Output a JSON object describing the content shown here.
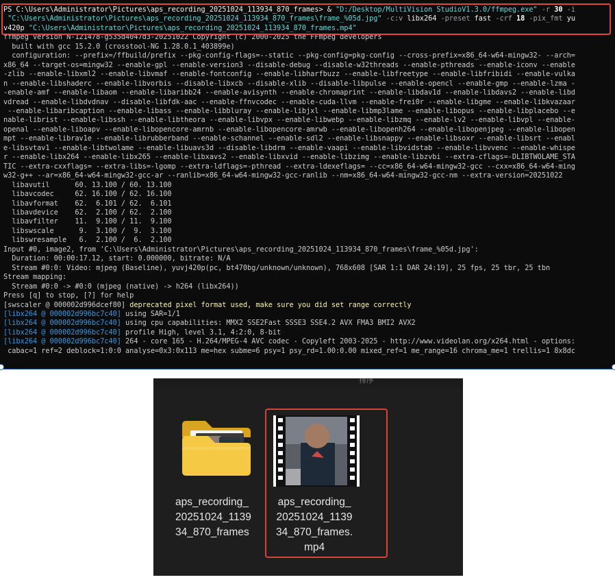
{
  "terminal": {
    "lines": [
      [
        [
          "PS C:\\Users\\Administrator\\Pictures\\aps_recording_20251024_113934_870_frames> ",
          "p"
        ],
        [
          "& ",
          "p"
        ],
        [
          "\"D:/Desktop/MultiVision StudioV1.3.0/ffmpeg.exe\"",
          "s"
        ],
        [
          " -r ",
          "g"
        ],
        [
          "30",
          "wb"
        ],
        [
          " -i",
          "g"
        ]
      ],
      [
        [
          " \"C:\\Users\\Administrator\\Pictures\\aps_recording_20251024_113934_870_frames\\frame_%05d.jpg\"",
          "s"
        ],
        [
          " -c:v ",
          "g"
        ],
        [
          "libx264",
          "p"
        ],
        [
          " -preset ",
          "g"
        ],
        [
          "fast",
          "p"
        ],
        [
          " -crf ",
          "g"
        ],
        [
          "18",
          "wb"
        ],
        [
          " -pix_fmt ",
          "g"
        ],
        [
          "yu",
          "p"
        ]
      ],
      [
        [
          "v420p ",
          "p"
        ],
        [
          "\"C:\\Users\\Administrator\\Pictures\\aps_recording_20251024_113934_870_frames.mp4\"",
          "s"
        ]
      ],
      [
        [
          "ffmpeg version N-121478-g535d4047d3-20251022 Copyright (c) 2000-2025 the FFmpeg developers",
          "w"
        ]
      ],
      [
        [
          "  built with gcc 15.2.0 (crosstool-NG 1.28.0.1_403899e)",
          "w"
        ]
      ],
      [
        [
          "  configuration: --prefix=/ffbuild/prefix --pkg-config-flags=--static --pkg-config=pkg-config --cross-prefix=x86_64-w64-mingw32- --arch=",
          "w"
        ]
      ],
      [
        [
          "x86_64 --target-os=mingw32 --enable-gpl --enable-version3 --disable-debug --disable-w32threads --enable-pthreads --enable-iconv --enable",
          "w"
        ]
      ],
      [
        [
          "-zlib --enable-libxml2 --enable-libvmaf --enable-fontconfig --enable-libharfbuzz --enable-libfreetype --enable-libfribidi --enable-vulka",
          "w"
        ]
      ],
      [
        [
          "n --enable-libshaderc --enable-libvorbis --disable-libxcb --disable-xlib --disable-libpulse --enable-opencl --enable-gmp --enable-lzma -",
          "w"
        ]
      ],
      [
        [
          "-enable-amf --enable-libaom --enable-libaribb24 --enable-avisynth --enable-chromaprint --enable-libdav1d --enable-libdavs2 --enable-libd",
          "w"
        ]
      ],
      [
        [
          "vdread --enable-libdvdnav --disable-libfdk-aac --enable-ffnvcodec --enable-cuda-llvm --enable-frei0r --enable-libgme --enable-libkvazaar",
          "w"
        ]
      ],
      [
        [
          " --enable-libaribcaption --enable-libass --enable-libbluray --enable-libjxl --enable-libmp3lame --enable-libopus --enable-libplacebo --e",
          "w"
        ]
      ],
      [
        [
          "nable-librist --enable-libssh --enable-libtheora --enable-libvpx --enable-libwebp --enable-libzmq --enable-lv2 --enable-libvpl --enable-",
          "w"
        ]
      ],
      [
        [
          "openal --enable-liboapv --enable-libopencore-amrnb --enable-libopencore-amrwb --enable-libopenh264 --enable-libopenjpeg --enable-libopen",
          "w"
        ]
      ],
      [
        [
          "mpt --enable-librav1e --enable-librubberband --enable-schannel --enable-sdl2 --enable-libsnappy --enable-libsoxr --enable-libsrt --enabl",
          "w"
        ]
      ],
      [
        [
          "e-libsvtav1 --enable-libtwolame --enable-libuavs3d --disable-libdrm --enable-vaapi --enable-libvidstab --enable-libvvenc --enable-whispe",
          "w"
        ]
      ],
      [
        [
          "r --enable-libx264 --enable-libx265 --enable-libxavs2 --enable-libxvid --enable-libzimg --enable-libzvbi --extra-cflags=-DLIBTWOLAME_STA",
          "w"
        ]
      ],
      [
        [
          "TIC --extra-cxxflags= --extra-libs=-lgomp --extra-ldflags=-pthread --extra-ldexeflags= --cc=x86_64-w64-mingw32-gcc --cxx=x86_64-w64-ming",
          "w"
        ]
      ],
      [
        [
          "w32-g++ --ar=x86_64-w64-mingw32-gcc-ar --ranlib=x86_64-w64-mingw32-gcc-ranlib --nm=x86_64-w64-mingw32-gcc-nm --extra-version=20251022",
          "w"
        ]
      ],
      [
        [
          "  libavutil      60. 13.100 / 60. 13.100",
          "w"
        ]
      ],
      [
        [
          "  libavcodec     62. 16.100 / 62. 16.100",
          "w"
        ]
      ],
      [
        [
          "  libavformat    62.  6.101 / 62.  6.101",
          "w"
        ]
      ],
      [
        [
          "  libavdevice    62.  2.100 / 62.  2.100",
          "w"
        ]
      ],
      [
        [
          "  libavfilter    11.  9.100 / 11.  9.100",
          "w"
        ]
      ],
      [
        [
          "  libswscale      9.  3.100 /  9.  3.100",
          "w"
        ]
      ],
      [
        [
          "  libswresample   6.  2.100 /  6.  2.100",
          "w"
        ]
      ],
      [
        [
          "Input #0, image2, from 'C:\\Users\\Administrator\\Pictures\\aps_recording_20251024_113934_870_frames\\frame_%05d.jpg':",
          "w"
        ]
      ],
      [
        [
          "  Duration: 00:00:17.12, start: 0.000000, bitrate: N/A",
          "w"
        ]
      ],
      [
        [
          "  Stream #0:0: Video: mjpeg (Baseline), yuvj420p(pc, bt470bg/unknown/unknown), 768x608 [SAR 1:1 DAR 24:19], 25 fps, 25 tbr, 25 tbn",
          "w"
        ]
      ],
      [
        [
          "Stream mapping:",
          "w"
        ]
      ],
      [
        [
          "  Stream #0:0 -> #0:0 (mjpeg (native) -> h264 (libx264))",
          "w"
        ]
      ],
      [
        [
          "Press [q] to stop, [?] for help",
          "w"
        ]
      ],
      [
        [
          "[swscaler @ 000002d996dcef80] ",
          "w"
        ],
        [
          "deprecated pixel format used, make sure you did set range correctly",
          "warn"
        ]
      ],
      [
        [
          "[libx264 @ 000002d996bc7c40]",
          "x"
        ],
        [
          " using SAR=1/1",
          "w"
        ]
      ],
      [
        [
          "[libx264 @ 000002d996bc7c40]",
          "x"
        ],
        [
          " using cpu capabilities: MMX2 SSE2Fast SSSE3 SSE4.2 AVX FMA3 BMI2 AVX2",
          "w"
        ]
      ],
      [
        [
          "[libx264 @ 000002d996bc7c40]",
          "x"
        ],
        [
          " profile High, level 3.1, 4:2:0, 8-bit",
          "w"
        ]
      ],
      [
        [
          "[libx264 @ 000002d996bc7c40]",
          "x"
        ],
        [
          " 264 - core 165 - H.264/MPEG-4 AVC codec - Copyleft 2003-2025 - http://www.videolan.org/x264.html - options:",
          "w"
        ]
      ],
      [
        [
          " cabac=1 ref=2 deblock=1:0:0 analyse=0x3:0x113 me=hex subme=6 psy=1 psy_rd=1.00:0.00 mixed_ref=1 me_range=16 chroma_me=1 trellis=1 8x8dc",
          "w"
        ]
      ]
    ]
  },
  "explorer": {
    "top_strip_text": "排序",
    "items": [
      {
        "name": "aps_recording_\n20251024_1139\n34_870_frames",
        "type": "folder-icon"
      },
      {
        "name": "aps_recording_\n20251024_1139\n34_870_frames.\nmp4",
        "type": "video-file-icon"
      }
    ]
  },
  "colors": {
    "terminal_bg": "#0c0c0c",
    "highlight_border": "#e0463c",
    "explorer_bg": "#1e1e1e",
    "folder_yellow": "#f4c542",
    "string_cyan": "#61d6d6",
    "warning_yellow": "#f9f1a5",
    "libx264_tag": "#3a96dd"
  }
}
